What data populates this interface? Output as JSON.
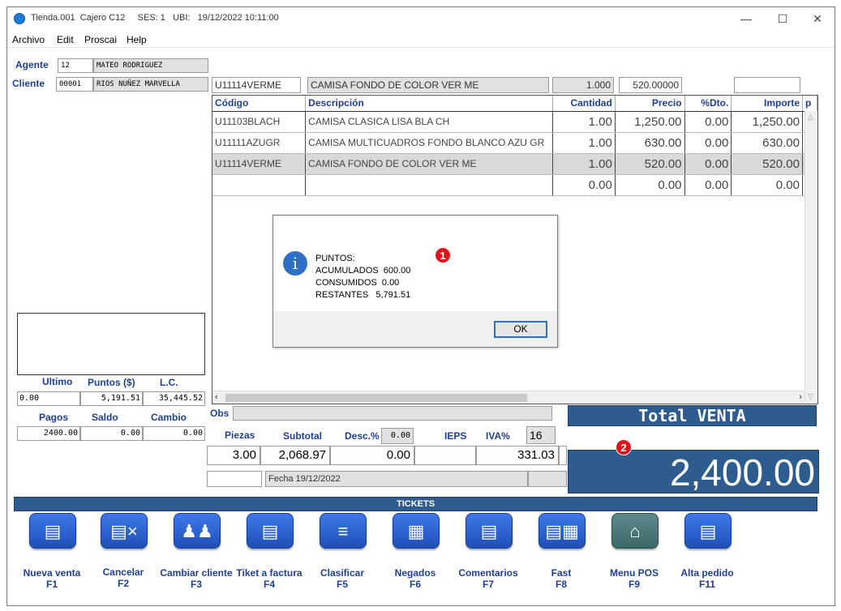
{
  "titlebar": {
    "title": "Tienda.001  Cajero C12     SES: 1   UBI:   19/12/2022 10:11:00"
  },
  "menu": [
    "Archivo",
    "Edit",
    "Proscai",
    "Help"
  ],
  "agente": {
    "label": "Agente",
    "code": "12",
    "name": "MATEO RODRIGUEZ"
  },
  "cliente": {
    "label": "Cliente",
    "code": "00001",
    "name": "RIOS NUÑEZ MARVELLA"
  },
  "entry": {
    "code": "U11114VERME",
    "description": "CAMISA FONDO DE COLOR VER ME",
    "quantity": "1.000",
    "price": "520.00000"
  },
  "grid": {
    "headers": [
      "Código",
      "Descripción",
      "Cantidad",
      "Precio",
      "%Dto.",
      "Importe",
      "p"
    ],
    "rows": [
      [
        "U11103BLACH",
        "CAMISA CLASICA LISA BLA CH",
        "1.00",
        "1,250.00",
        "0.00",
        "1,250.00"
      ],
      [
        "U11111AZUGR",
        "CAMISA MULTICUADROS FONDO BLANCO AZU GR",
        "1.00",
        "630.00",
        "0.00",
        "630.00"
      ],
      [
        "U11114VERME",
        "CAMISA FONDO DE COLOR VER ME",
        "1.00",
        "520.00",
        "0.00",
        "520.00"
      ],
      [
        "",
        "",
        "0.00",
        "0.00",
        "0.00",
        "0.00"
      ]
    ]
  },
  "dialog": {
    "message": "PUNTOS:\nACUMULADOS  600.00\nCONSUMIDOS  0.00\nRESTANTES   5,791.51",
    "ok": "OK"
  },
  "badges": [
    "1",
    "2"
  ],
  "stats": {
    "h1": "Ultimo",
    "h2": "Puntos ($)",
    "h3": "L.C.",
    "v1": "0.00",
    "v2": "5,191.51",
    "v3": "35,445.52"
  },
  "pagos": {
    "h1": "Pagos",
    "h2": "Saldo",
    "h3": "Cambio",
    "v1": "2400.00",
    "v2": "0.00",
    "v3": "0.00"
  },
  "totals": {
    "obs_label": "Obs",
    "piezas_label": "Piezas",
    "subtotal_label": "Subtotal",
    "desc_label": "Desc.%",
    "desc_value": "0.00",
    "ieps_label": "IEPS",
    "iva_label": "IVA%",
    "iva_rate": "16",
    "piezas": "3.00",
    "subtotal": "2,068.97",
    "desc": "0.00",
    "ieps": "",
    "iva": "331.03",
    "fecha": "Fecha 19/12/2022"
  },
  "total": {
    "label": "Total VENTA",
    "value": "2,400.00"
  },
  "tickets": {
    "title": "TICKETS",
    "buttons": [
      {
        "label": "Nueva venta",
        "key": "F1",
        "icon": "new-sale-icon"
      },
      {
        "label": "Cancelar",
        "key": "F2",
        "icon": "cancel-icon"
      },
      {
        "label": "Cambiar cliente",
        "key": "F3",
        "icon": "users-icon"
      },
      {
        "label": "Tiket a factura",
        "key": "F4",
        "icon": "invoice-icon"
      },
      {
        "label": "Clasificar",
        "key": "F5",
        "icon": "tree-icon"
      },
      {
        "label": "Negados",
        "key": "F6",
        "icon": "grid-icon"
      },
      {
        "label": "Comentarios",
        "key": "F7",
        "icon": "comments-icon"
      },
      {
        "label": "Fast",
        "key": "F8",
        "icon": "fast-icon"
      },
      {
        "label": "Menu POS",
        "key": "F9",
        "icon": "home-icon"
      },
      {
        "label": "Alta pedido",
        "key": "F11",
        "icon": "new-order-icon"
      }
    ]
  }
}
